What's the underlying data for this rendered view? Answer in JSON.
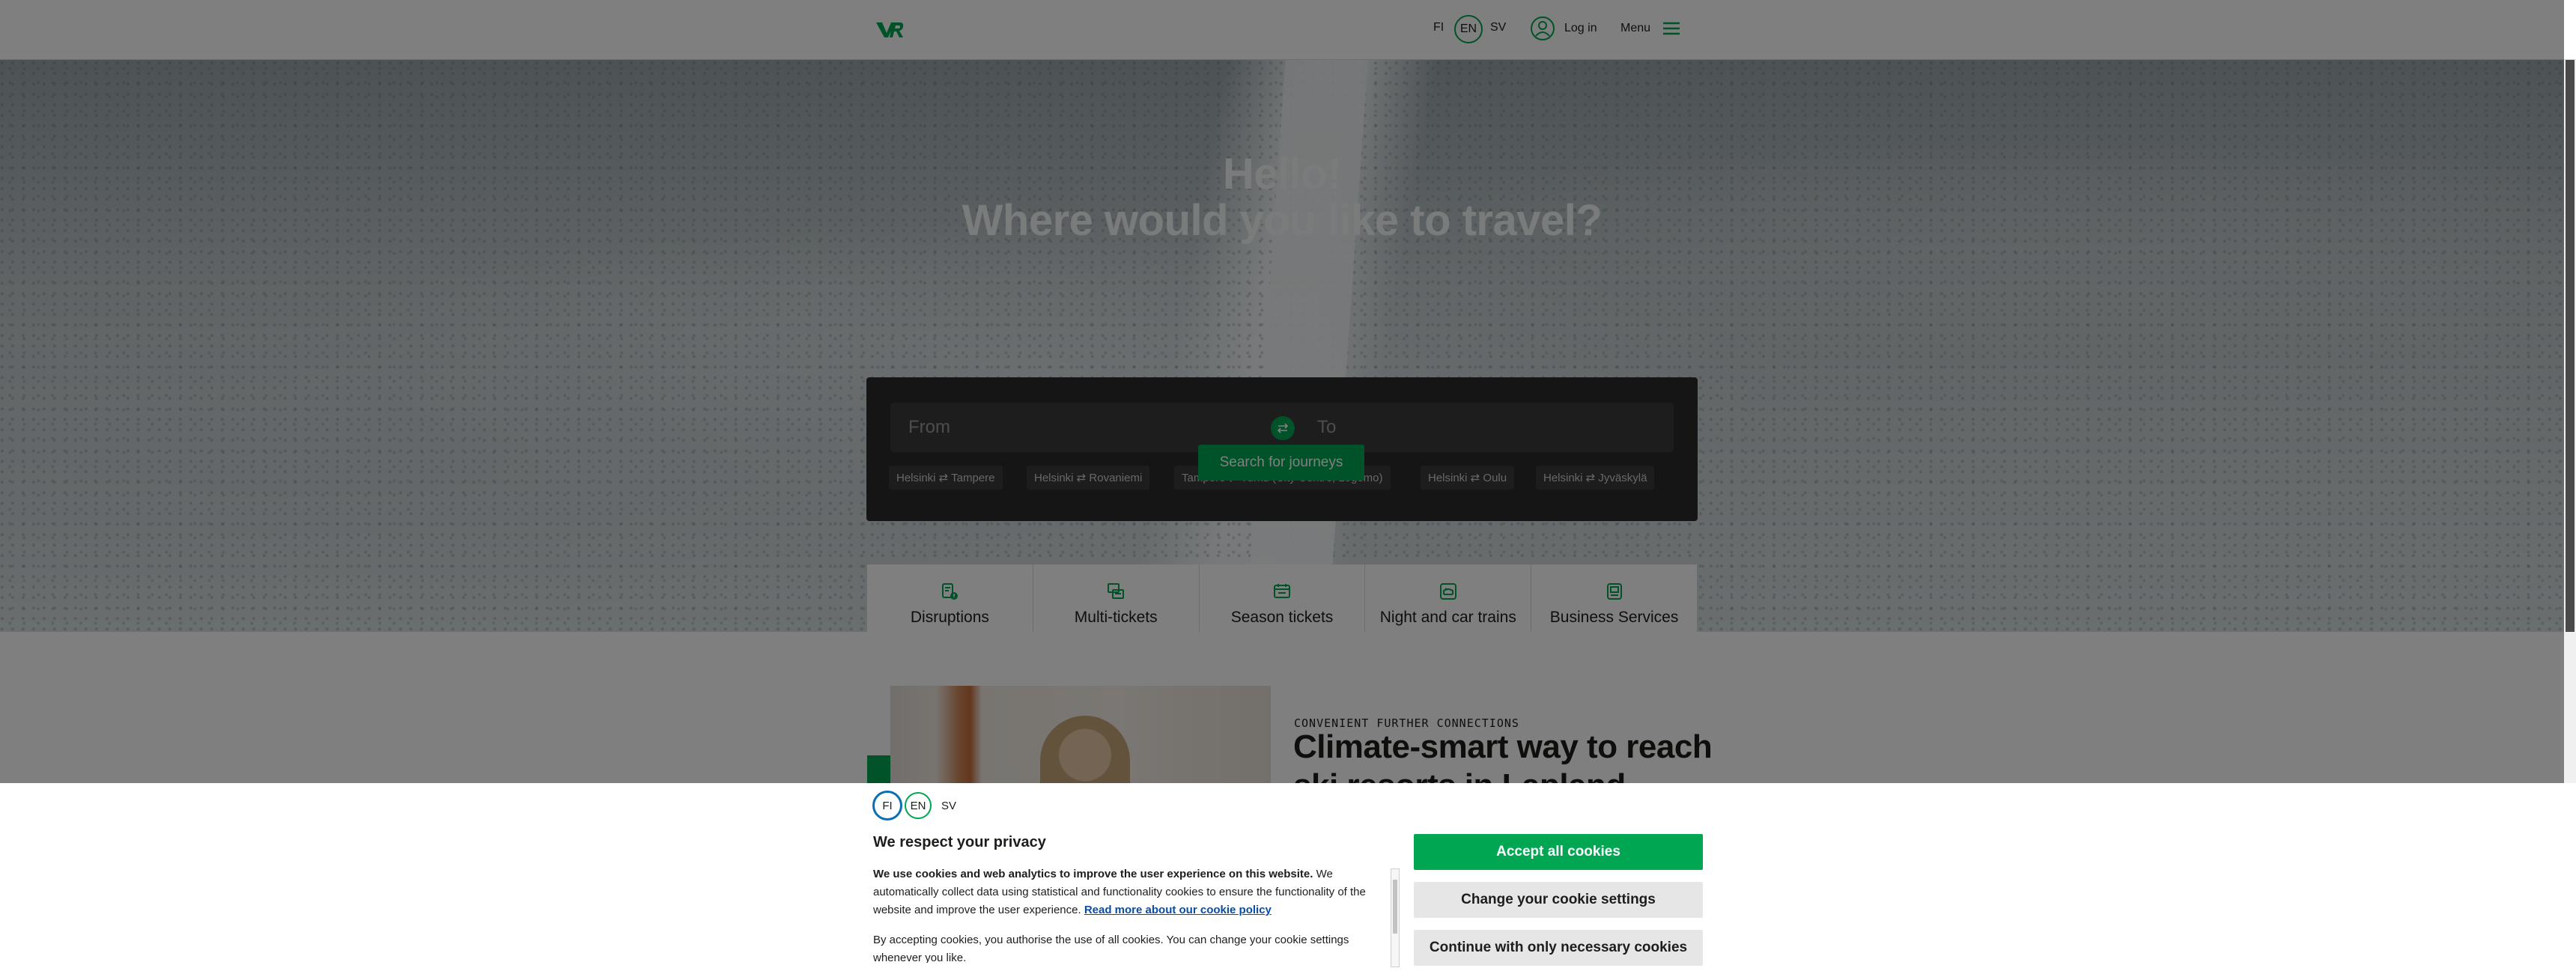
{
  "header": {
    "lang_fi": "FI",
    "lang_en": "EN",
    "lang_sv": "SV",
    "login_label": "Log in",
    "menu_label": "Menu"
  },
  "hero": {
    "title_line1": "Hello!",
    "title_line2": "Where would you like to travel?"
  },
  "search": {
    "from_placeholder": "From",
    "to_placeholder": "To",
    "quick_routes": [
      "Helsinki ⇄ Tampere",
      "Helsinki ⇄ Rovaniemi",
      "Tampere ⇄ Turku (City Centre, Logomo)",
      "Helsinki ⇄ Oulu",
      "Helsinki ⇄ Jyväskylä"
    ],
    "search_button": "Search for journeys"
  },
  "tiles": [
    {
      "label": "Disruptions",
      "icon": "disruptions-icon"
    },
    {
      "label": "Multi-tickets",
      "icon": "multi-tickets-icon"
    },
    {
      "label": "Season tickets",
      "icon": "season-tickets-icon"
    },
    {
      "label": "Night and car trains",
      "icon": "night-train-icon"
    },
    {
      "label": "Business Services",
      "icon": "business-icon"
    }
  ],
  "promo": {
    "eyebrow": "CONVENIENT FURTHER CONNECTIONS",
    "title": "Climate-smart way to reach ski resorts in Lapland"
  },
  "cookie": {
    "lang_fi": "FI",
    "lang_en": "EN",
    "lang_sv": "SV",
    "title": "We respect your privacy",
    "body_bold": "We use cookies and web analytics to improve the user experience on this website.",
    "body_text": " We automatically collect data using statistical and functionality cookies to ensure the functionality of the website and improve the user experience. ",
    "policy_link": "Read more about our cookie policy",
    "body_second": "By accepting cookies, you authorise the use of all cookies. You can change your cookie settings whenever you like.",
    "accept_button": "Accept all cookies",
    "settings_button": "Change your cookie settings",
    "necessary_button": "Continue with only necessary cookies"
  },
  "colors": {
    "brand_green": "#00a651",
    "link_blue": "#0a4da3"
  }
}
